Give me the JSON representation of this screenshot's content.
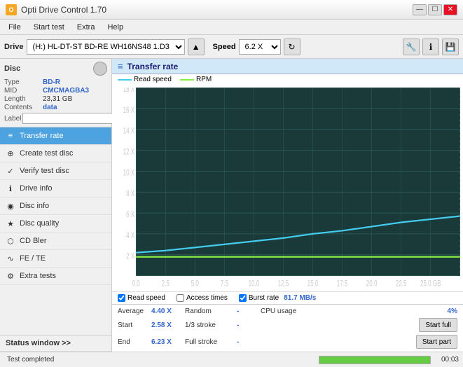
{
  "titleBar": {
    "title": "Opti Drive Control 1.70",
    "minimize": "—",
    "maximize": "☐",
    "close": "✕"
  },
  "menuBar": {
    "items": [
      "File",
      "Start test",
      "Extra",
      "Help"
    ]
  },
  "toolbar": {
    "driveLabel": "Drive",
    "driveValue": "(H:)  HL-DT-ST BD-RE  WH16NS48 1.D3",
    "speedLabel": "Speed",
    "speedValue": "6.2 X"
  },
  "disc": {
    "title": "Disc",
    "typeLabel": "Type",
    "typeValue": "BD-R",
    "midLabel": "MID",
    "midValue": "CMCMAGBA3",
    "lengthLabel": "Length",
    "lengthValue": "23,31 GB",
    "contentsLabel": "Contents",
    "contentsValue": "data",
    "labelLabel": "Label",
    "labelPlaceholder": ""
  },
  "navItems": [
    {
      "id": "transfer-rate",
      "label": "Transfer rate",
      "icon": "≡",
      "active": true
    },
    {
      "id": "create-test-disc",
      "label": "Create test disc",
      "icon": "⊕",
      "active": false
    },
    {
      "id": "verify-test-disc",
      "label": "Verify test disc",
      "icon": "✓",
      "active": false
    },
    {
      "id": "drive-info",
      "label": "Drive info",
      "icon": "ℹ",
      "active": false
    },
    {
      "id": "disc-info",
      "label": "Disc info",
      "icon": "◉",
      "active": false
    },
    {
      "id": "disc-quality",
      "label": "Disc quality",
      "icon": "★",
      "active": false
    },
    {
      "id": "cd-bler",
      "label": "CD Bler",
      "icon": "⬡",
      "active": false
    },
    {
      "id": "fe-te",
      "label": "FE / TE",
      "icon": "∿",
      "active": false
    },
    {
      "id": "extra-tests",
      "label": "Extra tests",
      "icon": "⚙",
      "active": false
    }
  ],
  "statusWindow": {
    "label": "Status window >>",
    "arrowIcon": ">>"
  },
  "chart": {
    "title": "Transfer rate",
    "icon": "≡",
    "legend": [
      {
        "label": "Read speed",
        "color": "#44ccee"
      },
      {
        "label": "RPM",
        "color": "#88ee44"
      }
    ],
    "yAxisLabels": [
      "18 X",
      "16 X",
      "14 X",
      "12 X",
      "10 X",
      "8 X",
      "6 X",
      "4 X",
      "2 X"
    ],
    "xAxisLabels": [
      "0.0",
      "2.5",
      "5.0",
      "7.5",
      "10.0",
      "12.5",
      "15.0",
      "17.5",
      "20.0",
      "22.5",
      "25.0 GB"
    ],
    "checkboxes": [
      {
        "id": "read-speed",
        "label": "Read speed",
        "checked": true
      },
      {
        "id": "access-times",
        "label": "Access times",
        "checked": false
      },
      {
        "id": "burst-rate",
        "label": "Burst rate",
        "checked": true,
        "value": "81.7 MB/s"
      }
    ]
  },
  "stats": {
    "rows": [
      {
        "label": "Average",
        "value": "4.40 X",
        "midLabel": "Random",
        "midValue": "-",
        "rightLabel": "CPU usage",
        "rightValue": "4%",
        "hasButton": false
      },
      {
        "label": "Start",
        "value": "2.58 X",
        "midLabel": "1/3 stroke",
        "midValue": "-",
        "rightLabel": "",
        "rightValue": "",
        "hasButton": true,
        "buttonLabel": "Start full"
      },
      {
        "label": "End",
        "value": "6.23 X",
        "midLabel": "Full stroke",
        "midValue": "-",
        "rightLabel": "",
        "rightValue": "",
        "hasButton": true,
        "buttonLabel": "Start part"
      }
    ]
  },
  "statusBar": {
    "statusText": "Test completed",
    "progress": 100,
    "time": "00:03"
  }
}
